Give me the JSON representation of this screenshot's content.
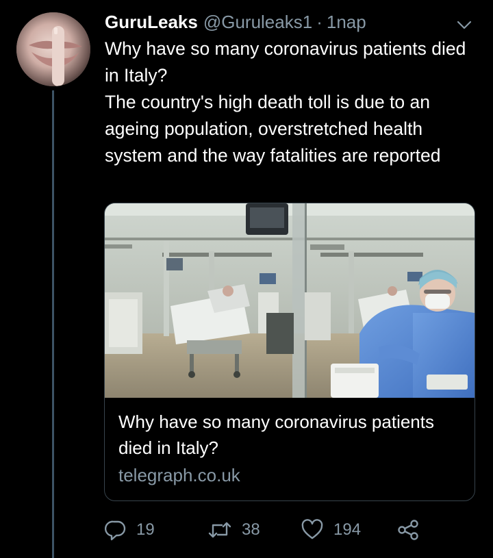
{
  "tweet": {
    "author_name": "GuruLeaks",
    "author_handle": "@Guruleaks1",
    "separator": "·",
    "timestamp": "1nap",
    "text_line1": "Why have so many coronavirus patients died in Italy?",
    "text_line2": "The country's high death toll is due to an ageing population, overstretched health system and the way fatalities are reported"
  },
  "card": {
    "title": "Why have so many coronavirus patients died in Italy?",
    "domain": "telegraph.co.uk"
  },
  "actions": {
    "replies": "19",
    "retweets": "38",
    "likes": "194"
  },
  "icons": {
    "avatar": "avatar-image",
    "caret": "chevron-down-icon",
    "reply": "reply-icon",
    "retweet": "retweet-icon",
    "like": "heart-icon",
    "share": "share-icon"
  },
  "colors": {
    "background": "#000000",
    "text": "#ffffff",
    "muted": "#8899a6",
    "border": "#38444d",
    "thread_line": "#3d5466"
  }
}
